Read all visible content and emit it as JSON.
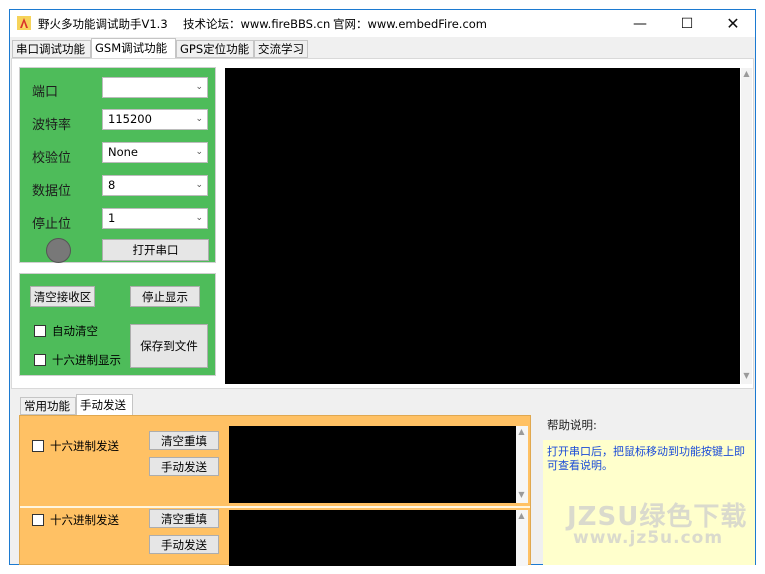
{
  "window": {
    "title": "野火多功能调试助手V1.3",
    "forum": "技术论坛：www.fireBBS.cn",
    "site": "官网：www.embedFire.com",
    "controls": {
      "minimize": "—",
      "maximize": "☐",
      "close": "✕"
    }
  },
  "tabs": [
    {
      "label": "串口调试功能"
    },
    {
      "label": "GSM调试功能"
    },
    {
      "label": "GPS定位功能"
    },
    {
      "label": "交流学习"
    }
  ],
  "active_tab": "GSM调试功能",
  "config": {
    "port": {
      "label": "端口",
      "value": ""
    },
    "baud": {
      "label": "波特率",
      "value": "115200"
    },
    "parity": {
      "label": "校验位",
      "value": "None"
    },
    "databits": {
      "label": "数据位",
      "value": "8"
    },
    "stopbits": {
      "label": "停止位",
      "value": "1"
    },
    "open_port_label": "打开串口",
    "indicator_color": "#787878"
  },
  "receive": {
    "clear_label": "清空接收区",
    "stop_label": "停止显示",
    "auto_clear_label": "自动清空",
    "hex_display_label": "十六进制显示",
    "save_label": "保存到文件"
  },
  "bottom_tabs": [
    {
      "label": "常用功能"
    },
    {
      "label": "手动发送"
    }
  ],
  "send": {
    "rows": [
      {
        "hex_label": "十六进制发送",
        "clear_label": "清空重填",
        "send_label": "手动发送"
      },
      {
        "hex_label": "十六进制发送",
        "clear_label": "清空重填",
        "send_label": "手动发送"
      }
    ]
  },
  "help": {
    "title": "帮助说明:",
    "text": "打开串口后，把鼠标移动到功能按键上即可查看说明。"
  },
  "watermark": {
    "line1": "JZSU绿色下载",
    "line2": "www.jz5u.com"
  },
  "colors": {
    "green_panel": "#4ebc5a",
    "orange_panel": "#ffc164",
    "help_bg": "#ffffcc",
    "help_text": "#1a4bd8"
  }
}
